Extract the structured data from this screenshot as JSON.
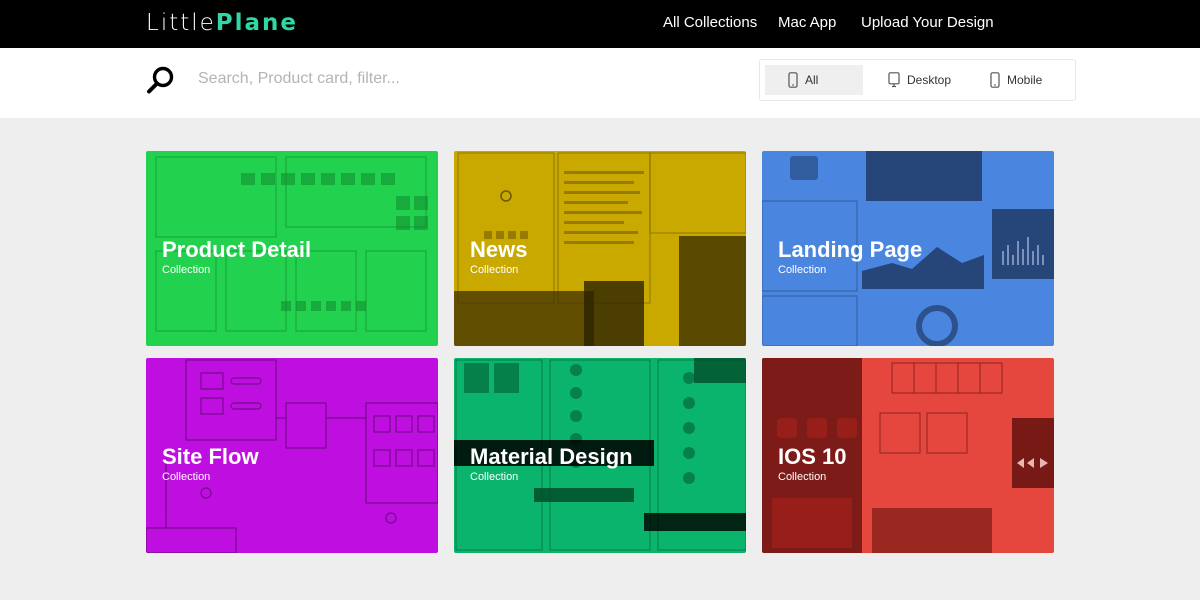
{
  "header": {
    "logo_light": "Little",
    "logo_bold": "Plane",
    "nav": [
      {
        "label": "All Collections"
      },
      {
        "label": "Mac App"
      },
      {
        "label": "Upload Your Design"
      }
    ]
  },
  "search": {
    "placeholder": "Search, Product card, filter...",
    "value": ""
  },
  "filters": [
    {
      "label": "All",
      "icon": "mobile-icon",
      "active": true
    },
    {
      "label": "Desktop",
      "icon": "desktop-icon",
      "active": false
    },
    {
      "label": "Mobile",
      "icon": "mobile-icon",
      "active": false
    }
  ],
  "cards": [
    {
      "title": "Product Detail",
      "subtitle": "Collection",
      "color": "#22d24e"
    },
    {
      "title": "News",
      "subtitle": "Collection",
      "color": "#c9a900"
    },
    {
      "title": "Landing Page",
      "subtitle": "Collection",
      "color": "#4a86e0"
    },
    {
      "title": "Site Flow",
      "subtitle": "Collection",
      "color": "#bf0fe0"
    },
    {
      "title": "Material Design",
      "subtitle": "Collection",
      "color": "#0ab46c"
    },
    {
      "title": "IOS 10",
      "subtitle": "Collection",
      "color": "#e5473e"
    }
  ],
  "colors": {
    "topbar": "#000000",
    "accent": "#2fd6a6"
  }
}
